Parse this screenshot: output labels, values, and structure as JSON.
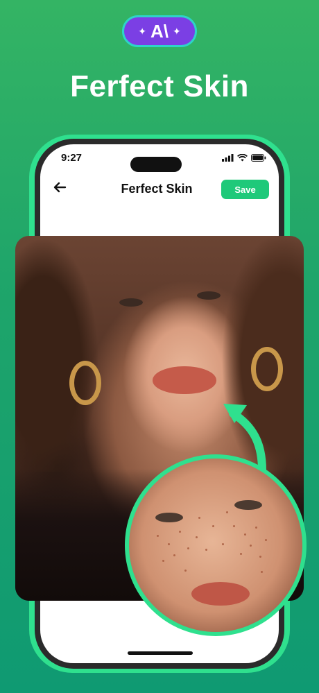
{
  "badge": {
    "label": "A\\"
  },
  "headline": "Ferfect Skin",
  "phone": {
    "status_time": "9:27",
    "nav_title": "Ferfect Skin",
    "save_label": "Save"
  },
  "colors": {
    "accent_green": "#1fc97a",
    "badge_purple": "#7b3fe4",
    "frame_green": "#2fe08e"
  }
}
